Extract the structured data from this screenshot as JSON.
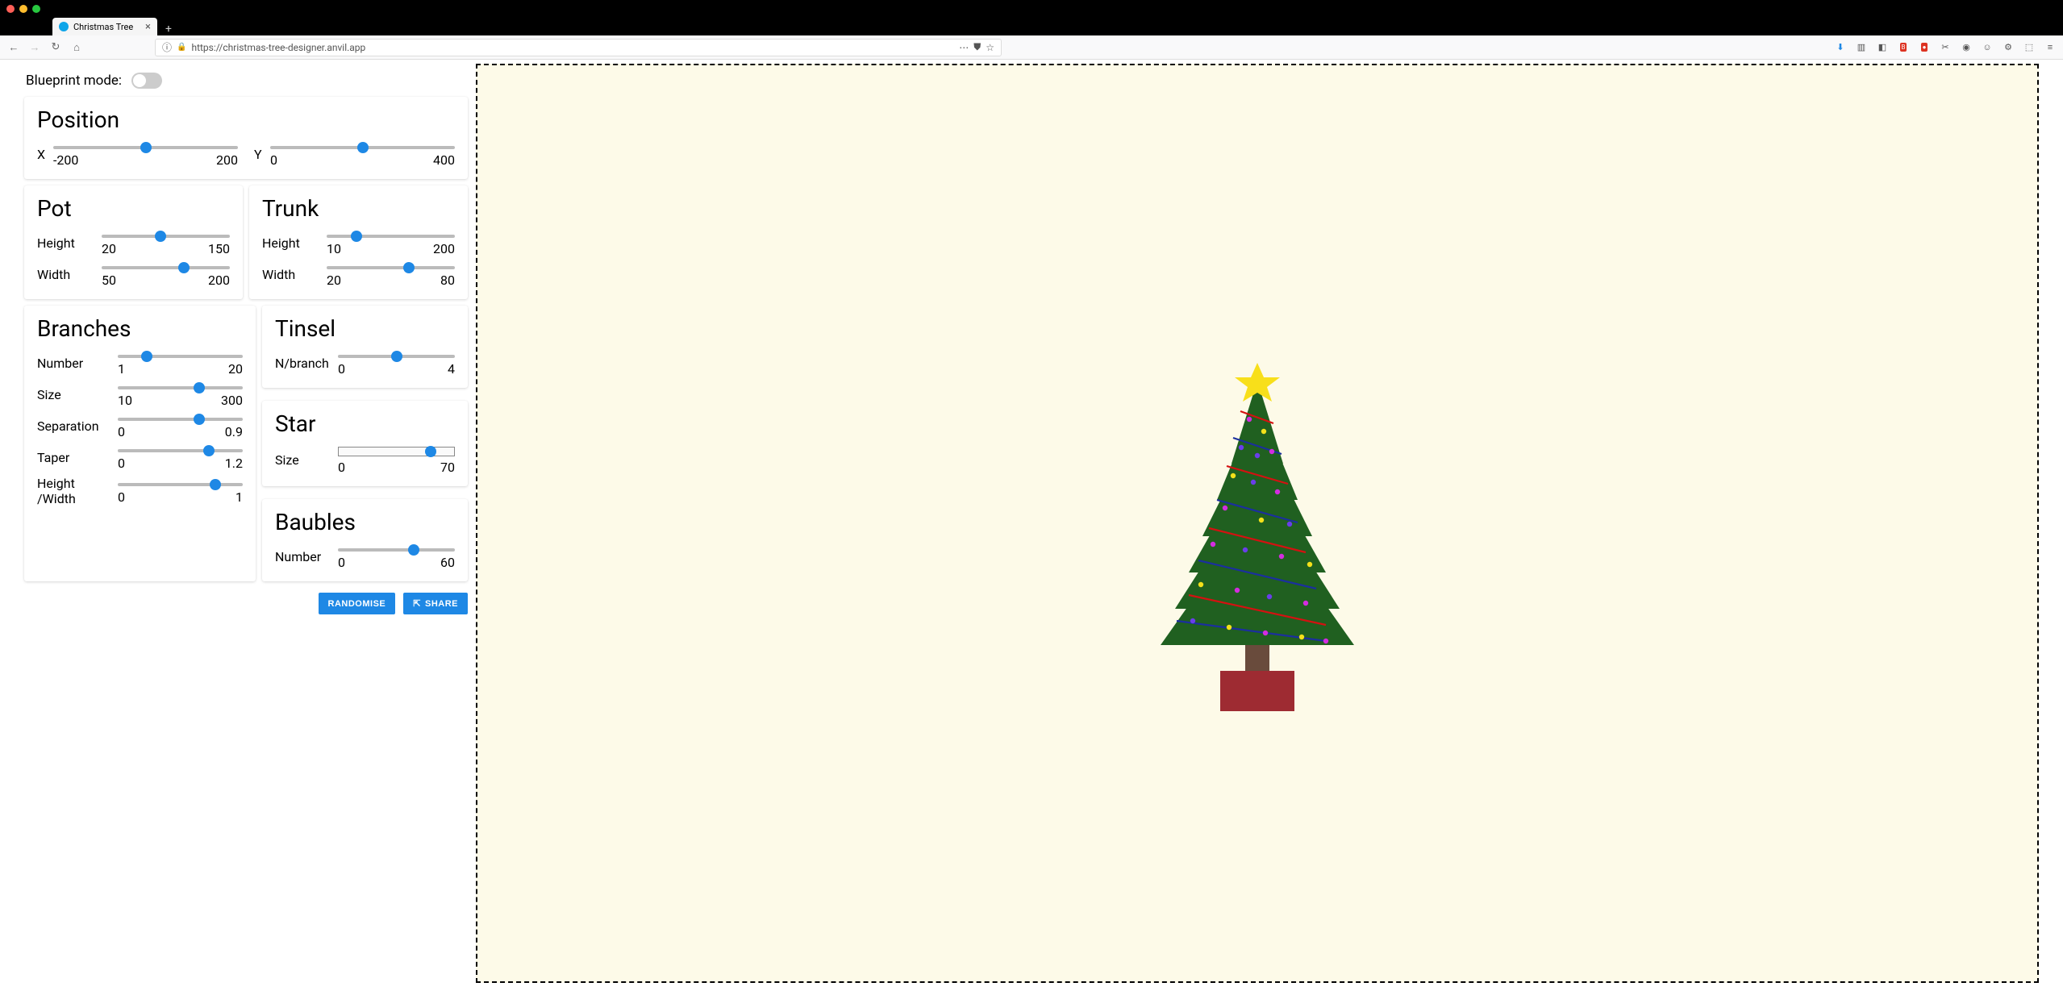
{
  "browser": {
    "tab_title": "Christmas Tree",
    "url": "https://christmas-tree-designer.anvil.app",
    "traffic_colors": [
      "#ff5f57",
      "#ffbd2e",
      "#28c840"
    ]
  },
  "header": {
    "blueprint_label": "Blueprint mode:",
    "blueprint_on": false
  },
  "panels": {
    "position": {
      "title": "Position",
      "x": {
        "label": "X",
        "min": "-200",
        "max": "200",
        "pct": 50
      },
      "y": {
        "label": "Y",
        "min": "0",
        "max": "400",
        "pct": 50
      }
    },
    "pot": {
      "title": "Pot",
      "height": {
        "label": "Height",
        "min": "20",
        "max": "150",
        "pct": 46
      },
      "width": {
        "label": "Width",
        "min": "50",
        "max": "200",
        "pct": 64
      }
    },
    "trunk": {
      "title": "Trunk",
      "height": {
        "label": "Height",
        "min": "10",
        "max": "200",
        "pct": 23
      },
      "width": {
        "label": "Width",
        "min": "20",
        "max": "80",
        "pct": 64
      }
    },
    "branches": {
      "title": "Branches",
      "number": {
        "label": "Number",
        "min": "1",
        "max": "20",
        "pct": 23
      },
      "size": {
        "label": "Size",
        "min": "10",
        "max": "300",
        "pct": 65
      },
      "separation": {
        "label": "Separation",
        "min": "0",
        "max": "0.9",
        "pct": 65
      },
      "taper": {
        "label": "Taper",
        "min": "0",
        "max": "1.2",
        "pct": 73
      },
      "hw": {
        "label": "Height /Width",
        "min": "0",
        "max": "1",
        "pct": 78
      }
    },
    "tinsel": {
      "title": "Tinsel",
      "nbranch": {
        "label": "N/branch",
        "min": "0",
        "max": "4",
        "pct": 50
      }
    },
    "star": {
      "title": "Star",
      "size": {
        "label": "Size",
        "min": "0",
        "max": "70",
        "pct": 80
      }
    },
    "baubles": {
      "title": "Baubles",
      "number": {
        "label": "Number",
        "min": "0",
        "max": "60",
        "pct": 65
      }
    }
  },
  "buttons": {
    "randomise": "RANDOMISE",
    "share": "SHARE"
  },
  "colors": {
    "accent": "#1e88e5",
    "tree": "#206020",
    "trunk": "#694b3c",
    "pot": "#9e2b32",
    "star": "#f8df1a",
    "canvas_bg": "#fdfae8",
    "tinsel": [
      "#1b2f9e",
      "#d41111"
    ]
  }
}
